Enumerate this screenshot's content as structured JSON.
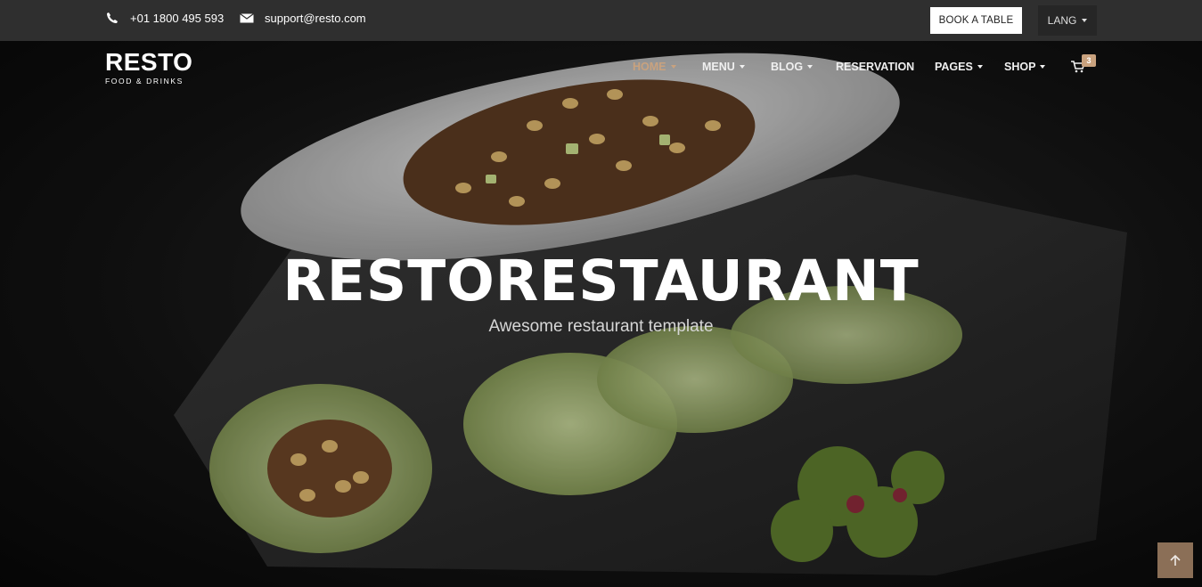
{
  "topbar": {
    "phone": "+01 1800 495 593",
    "email": "support@resto.com",
    "book_label": "BOOK A TABLE",
    "lang_label": "LANG",
    "icons": {
      "phone": "phone-icon",
      "email": "envelope-icon"
    }
  },
  "brand": {
    "name": "RESTO",
    "tagline": "FOOD & DRINKS"
  },
  "nav": {
    "items": [
      {
        "label": "HOME",
        "dropdown": true,
        "active": true
      },
      {
        "label": "MENU",
        "dropdown": true,
        "active": false
      },
      {
        "label": "BLOG",
        "dropdown": true,
        "active": false
      },
      {
        "label": "RESERVATION",
        "dropdown": false,
        "active": false
      },
      {
        "label": "PAGES",
        "dropdown": true,
        "active": false
      },
      {
        "label": "SHOP",
        "dropdown": true,
        "active": false
      }
    ],
    "cart_count": "3"
  },
  "hero": {
    "title": "RESTORESTAURANT",
    "subtitle": "Awesome restaurant template"
  },
  "colors": {
    "accent": "#c9a27e",
    "topbar": "#2f2f2f",
    "scroll_button": "#8b6f57"
  }
}
